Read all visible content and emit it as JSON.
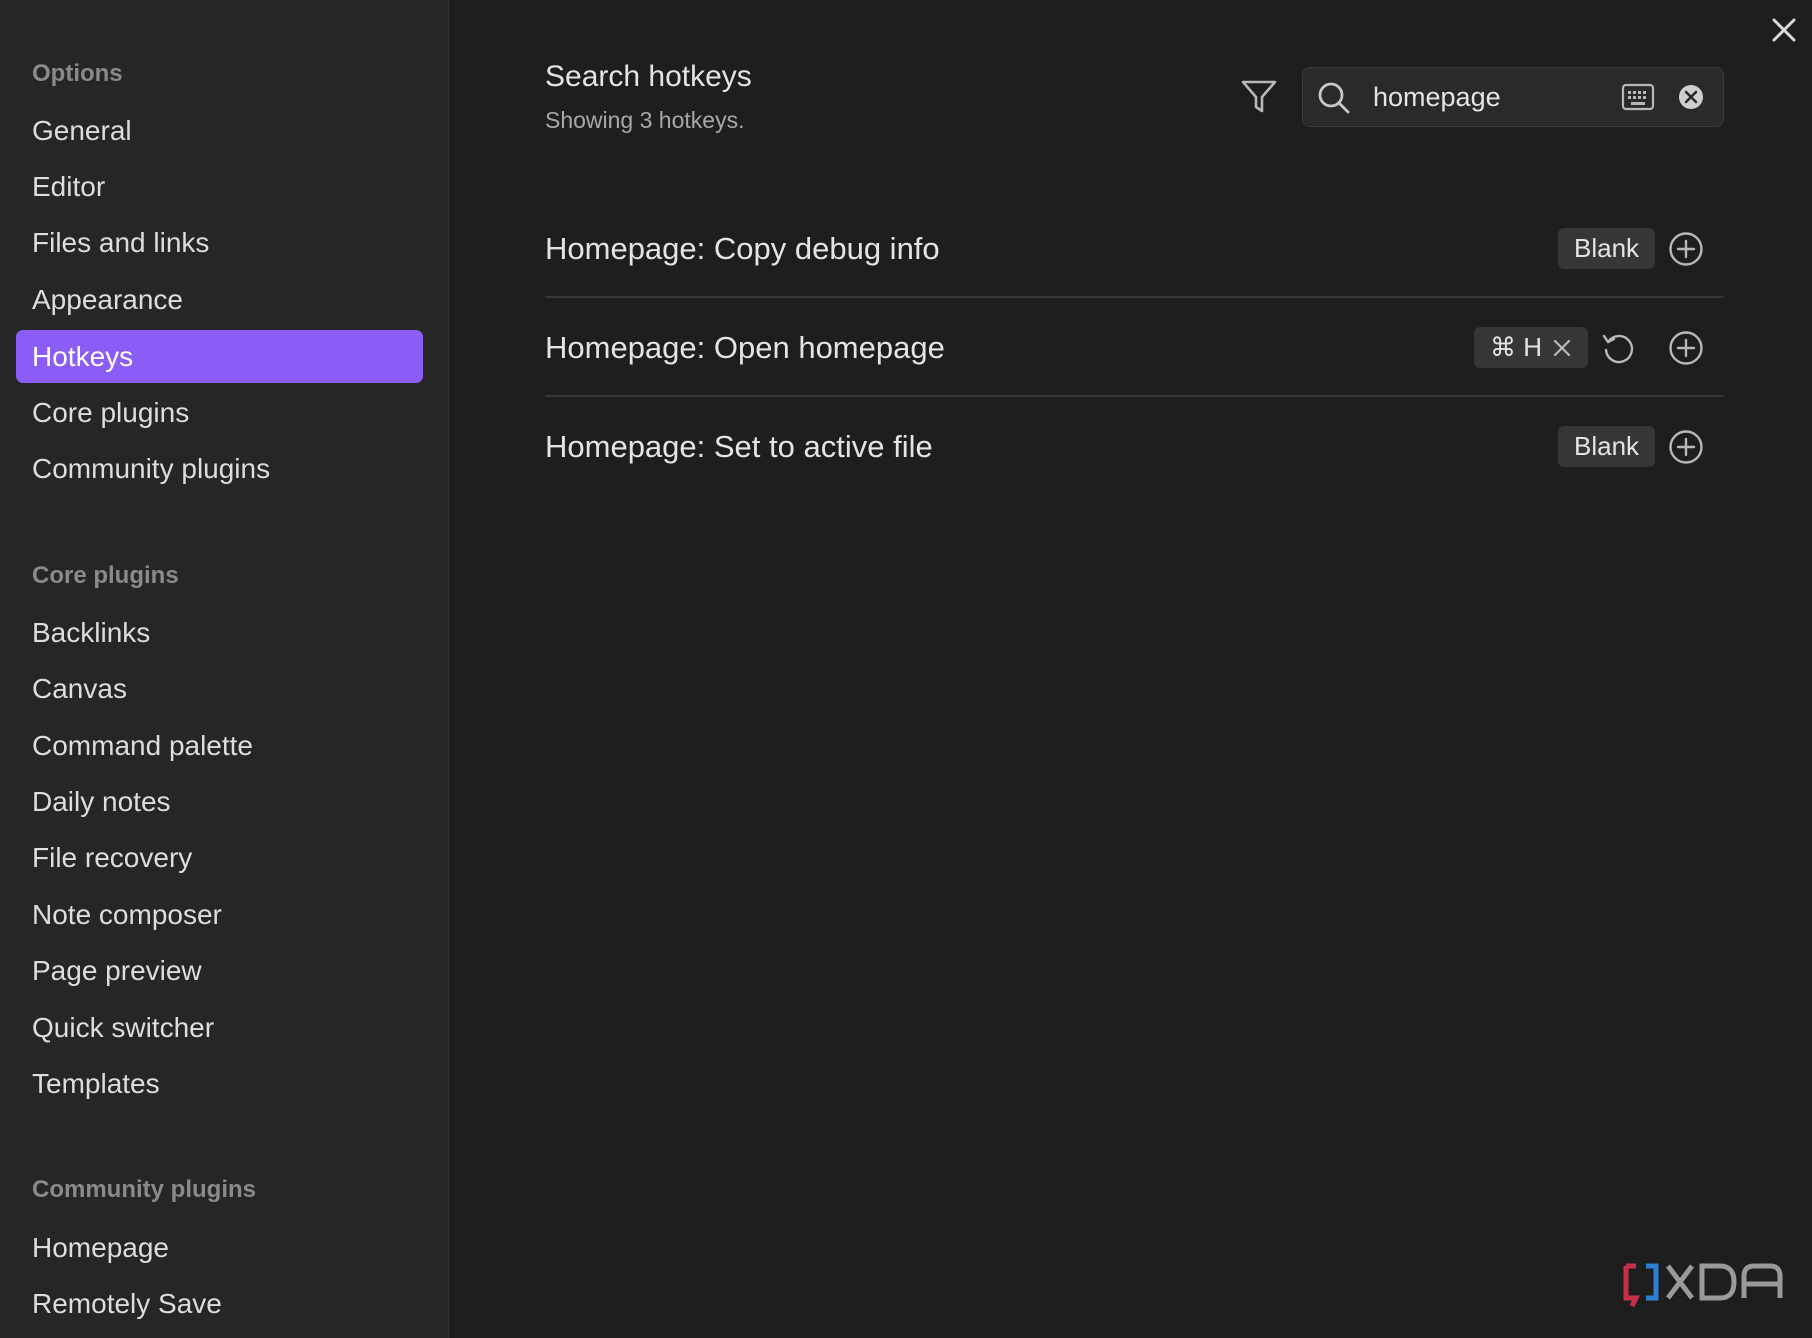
{
  "sidebar": {
    "options_title": "Options",
    "options_items": [
      "General",
      "Editor",
      "Files and links",
      "Appearance",
      "Hotkeys",
      "Core plugins",
      "Community plugins"
    ],
    "active_item": "Hotkeys",
    "core_title": "Core plugins",
    "core_items": [
      "Backlinks",
      "Canvas",
      "Command palette",
      "Daily notes",
      "File recovery",
      "Note composer",
      "Page preview",
      "Quick switcher",
      "Templates"
    ],
    "community_title": "Community plugins",
    "community_items": [
      "Homepage",
      "Remotely Save"
    ]
  },
  "header": {
    "title": "Search hotkeys",
    "subtitle": "Showing 3 hotkeys."
  },
  "search": {
    "value": "homepage",
    "icons": [
      "filter-icon",
      "search-icon",
      "keyboard-icon",
      "clear-icon"
    ]
  },
  "hotkeys": [
    {
      "name": "Homepage: Copy debug info",
      "binding": "Blank"
    },
    {
      "name": "Homepage: Open homepage",
      "binding": "⌘ H"
    },
    {
      "name": "Homepage: Set to active file",
      "binding": "Blank"
    }
  ],
  "colors": {
    "accent": "#8b5cf6",
    "background": "#1e1e1e",
    "sidebar": "#262626"
  }
}
